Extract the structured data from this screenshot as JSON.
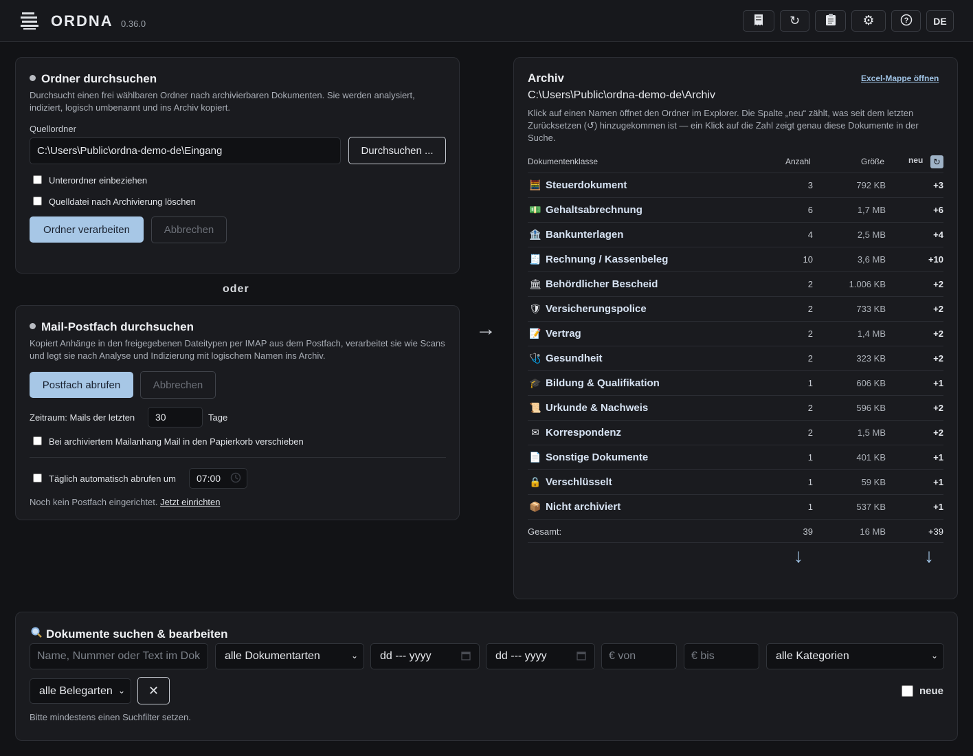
{
  "header": {
    "brand": "ORDNA",
    "version": "0.36.0",
    "lang": "DE",
    "buttons": [
      "document-icon",
      "refresh-icon",
      "clipboard-icon",
      "gear-icon",
      "help-icon"
    ]
  },
  "folder_panel": {
    "title": "Ordner durchsuchen",
    "description": "Durchsucht einen frei wählbaren Ordner nach archivierbaren Dokumenten. Sie werden analysiert, indiziert, logisch umbenannt und ins Archiv kopiert.",
    "source_label": "Quellordner",
    "source_value": "C:\\Users\\Public\\ordna-demo-de\\Eingang",
    "browse_label": "Durchsuchen ...",
    "include_subfolders": "Unterordner einbeziehen",
    "delete_after": "Quelldatei nach Archivierung löschen",
    "process_label": "Ordner verarbeiten",
    "cancel_label": "Abbrechen"
  },
  "oder": "oder",
  "mail_panel": {
    "title": "Mail-Postfach durchsuchen",
    "description": "Kopiert Anhänge in den freigegebenen Dateitypen per IMAP aus dem Postfach, verarbeitet sie wie Scans und legt sie nach Analyse und Indizierung mit logischem Namen ins Archiv.",
    "fetch_label": "Postfach abrufen",
    "cancel_label": "Abbrechen",
    "range_prefix": "Zeitraum: Mails der letzten",
    "range_value": "30",
    "range_suffix": "Tage",
    "trash_option": "Bei archiviertem Mailanhang Mail in den Papierkorb verschieben",
    "auto_fetch": "Täglich automatisch abrufen um",
    "auto_time": "07:00",
    "no_mailbox": "Noch kein Postfach eingerichtet.",
    "setup_link": "Jetzt einrichten"
  },
  "archive": {
    "title": "Archiv",
    "excel_link": "Excel-Mappe öffnen",
    "path": "C:\\Users\\Public\\ordna-demo-de\\Archiv",
    "description": "Klick auf einen Namen öffnet den Ordner im Explorer. Die Spalte „neu“ zählt, was seit dem letzten Zurücksetzen (↺) hinzugekommen ist — ein Klick auf die Zahl zeigt genau diese Dokumente in der Suche.",
    "columns": {
      "class": "Dokumentenklasse",
      "count": "Anzahl",
      "size": "Größe",
      "new": "neu"
    },
    "rows": [
      {
        "icon": "🧮",
        "name": "Steuerdokument",
        "count": "3",
        "size": "792 KB",
        "new": "+3"
      },
      {
        "icon": "💵",
        "name": "Gehaltsabrechnung",
        "count": "6",
        "size": "1,7 MB",
        "new": "+6"
      },
      {
        "icon": "🏦",
        "name": "Bankunterlagen",
        "count": "4",
        "size": "2,5 MB",
        "new": "+4"
      },
      {
        "icon": "🧾",
        "name": "Rechnung / Kassenbeleg",
        "count": "10",
        "size": "3,6 MB",
        "new": "+10"
      },
      {
        "icon": "🏛",
        "name": "Behördlicher Bescheid",
        "count": "2",
        "size": "1.006 KB",
        "new": "+2"
      },
      {
        "icon": "🛡",
        "name": "Versicherungspolice",
        "count": "2",
        "size": "733 KB",
        "new": "+2"
      },
      {
        "icon": "📝",
        "name": "Vertrag",
        "count": "2",
        "size": "1,4 MB",
        "new": "+2"
      },
      {
        "icon": "🩺",
        "name": "Gesundheit",
        "count": "2",
        "size": "323 KB",
        "new": "+2"
      },
      {
        "icon": "🎓",
        "name": "Bildung & Qualifikation",
        "count": "1",
        "size": "606 KB",
        "new": "+1"
      },
      {
        "icon": "📜",
        "name": "Urkunde & Nachweis",
        "count": "2",
        "size": "596 KB",
        "new": "+2"
      },
      {
        "icon": "✉",
        "name": "Korrespondenz",
        "count": "2",
        "size": "1,5 MB",
        "new": "+2"
      },
      {
        "icon": "📄",
        "name": "Sonstige Dokumente",
        "count": "1",
        "size": "401 KB",
        "new": "+1"
      },
      {
        "icon": "🔒",
        "name": "Verschlüsselt",
        "count": "1",
        "size": "59 KB",
        "new": "+1"
      },
      {
        "icon": "📦",
        "name": "Nicht archiviert",
        "count": "1",
        "size": "537 KB",
        "new": "+1"
      }
    ],
    "total": {
      "label": "Gesamt:",
      "count": "39",
      "size": "16 MB",
      "new": "+39"
    }
  },
  "search": {
    "title": "Dokumente suchen & bearbeiten",
    "text_placeholder": "Name, Nummer oder Text im Dok",
    "doc_type": "alle Dokumentarten",
    "date_from": "dd --- yyyy",
    "date_to": "dd --- yyyy",
    "amount_from": "€ von",
    "amount_to": "€ bis",
    "category": "alle Kategorien",
    "receipt_type": "alle Belegarten",
    "new_label": "neue",
    "hint": "Bitte mindestens einen Suchfilter setzen."
  }
}
